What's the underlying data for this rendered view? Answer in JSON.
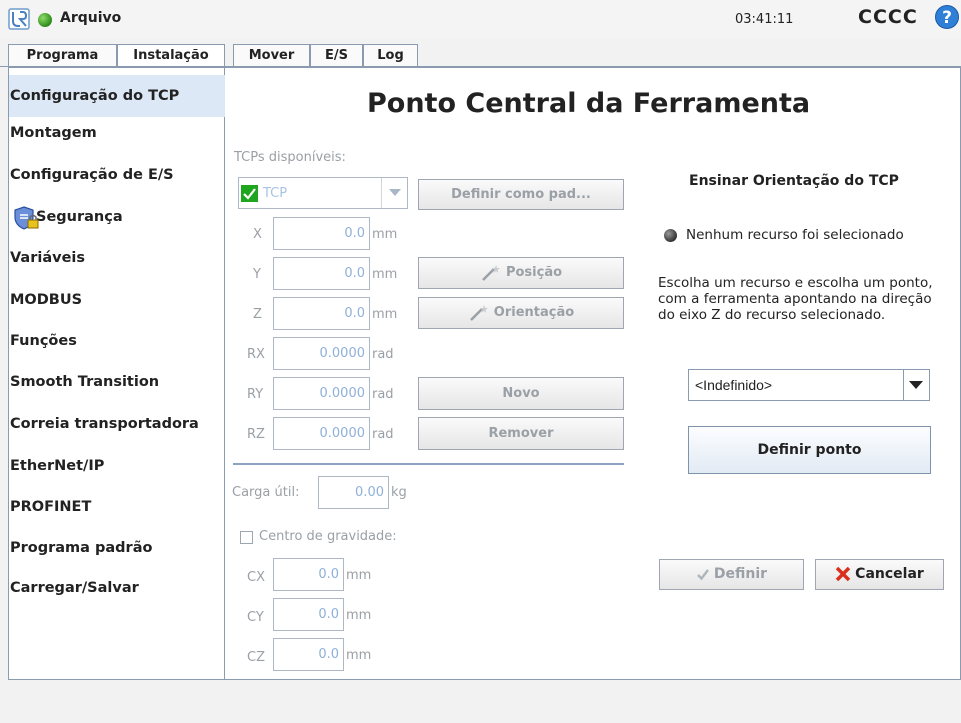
{
  "titlebar": {
    "app_title": "Arquivo",
    "clock": "03:41:11",
    "robot_name": "CCCC",
    "help_label": "?"
  },
  "tabs": [
    {
      "label": "Programa"
    },
    {
      "label": "Instalação"
    },
    {
      "label": "Mover"
    },
    {
      "label": "E/S"
    },
    {
      "label": "Log"
    }
  ],
  "sidebar": {
    "items": [
      {
        "label": "Configuração do TCP"
      },
      {
        "label": "Montagem"
      },
      {
        "label": "Configuração de E/S"
      },
      {
        "label": "Segurança"
      },
      {
        "label": "Variáveis"
      },
      {
        "label": "MODBUS"
      },
      {
        "label": "Funções"
      },
      {
        "label": "Smooth Transition"
      },
      {
        "label": "Correia transportadora"
      },
      {
        "label": "EtherNet/IP"
      },
      {
        "label": "PROFINET"
      },
      {
        "label": "Programa padrão"
      },
      {
        "label": "Carregar/Salvar"
      }
    ]
  },
  "main": {
    "heading": "Ponto Central da Ferramenta",
    "tcps_label": "TCPs disponíveis:",
    "tcp_selected": "TCP",
    "set_default_label": "Definir como pad...",
    "position_button": "Posição",
    "orientation_button": "Orientação",
    "new_button": "Novo",
    "remove_button": "Remover",
    "coords": [
      {
        "label": "X",
        "value": "0.0",
        "unit": "mm"
      },
      {
        "label": "Y",
        "value": "0.0",
        "unit": "mm"
      },
      {
        "label": "Z",
        "value": "0.0",
        "unit": "mm"
      },
      {
        "label": "RX",
        "value": "0.0000",
        "unit": "rad"
      },
      {
        "label": "RY",
        "value": "0.0000",
        "unit": "rad"
      },
      {
        "label": "RZ",
        "value": "0.0000",
        "unit": "rad"
      }
    ],
    "payload_label": "Carga útil:",
    "payload_value": "0.00",
    "payload_unit": "kg",
    "cog_label": "Centro de gravidade:",
    "cog": [
      {
        "label": "CX",
        "value": "0.0",
        "unit": "mm"
      },
      {
        "label": "CY",
        "value": "0.0",
        "unit": "mm"
      },
      {
        "label": "CZ",
        "value": "0.0",
        "unit": "mm"
      }
    ]
  },
  "orientation_panel": {
    "title": "Ensinar Orientação do TCP",
    "status": "Nenhum recurso foi selecionado",
    "instructions": "Escolha um recurso e escolha um ponto, com a ferramenta apontando na direção do eixo Z do recurso selecionado.",
    "feature_select": "<Indefinido>",
    "set_point_button": "Definir ponto",
    "define_button": "Definir",
    "cancel_button": "Cancelar"
  },
  "colors": {
    "accent": "#2f7fd6",
    "selected_bg": "#dce8f5",
    "cancel_red": "#d9301c",
    "check_green": "#1fa61f"
  }
}
